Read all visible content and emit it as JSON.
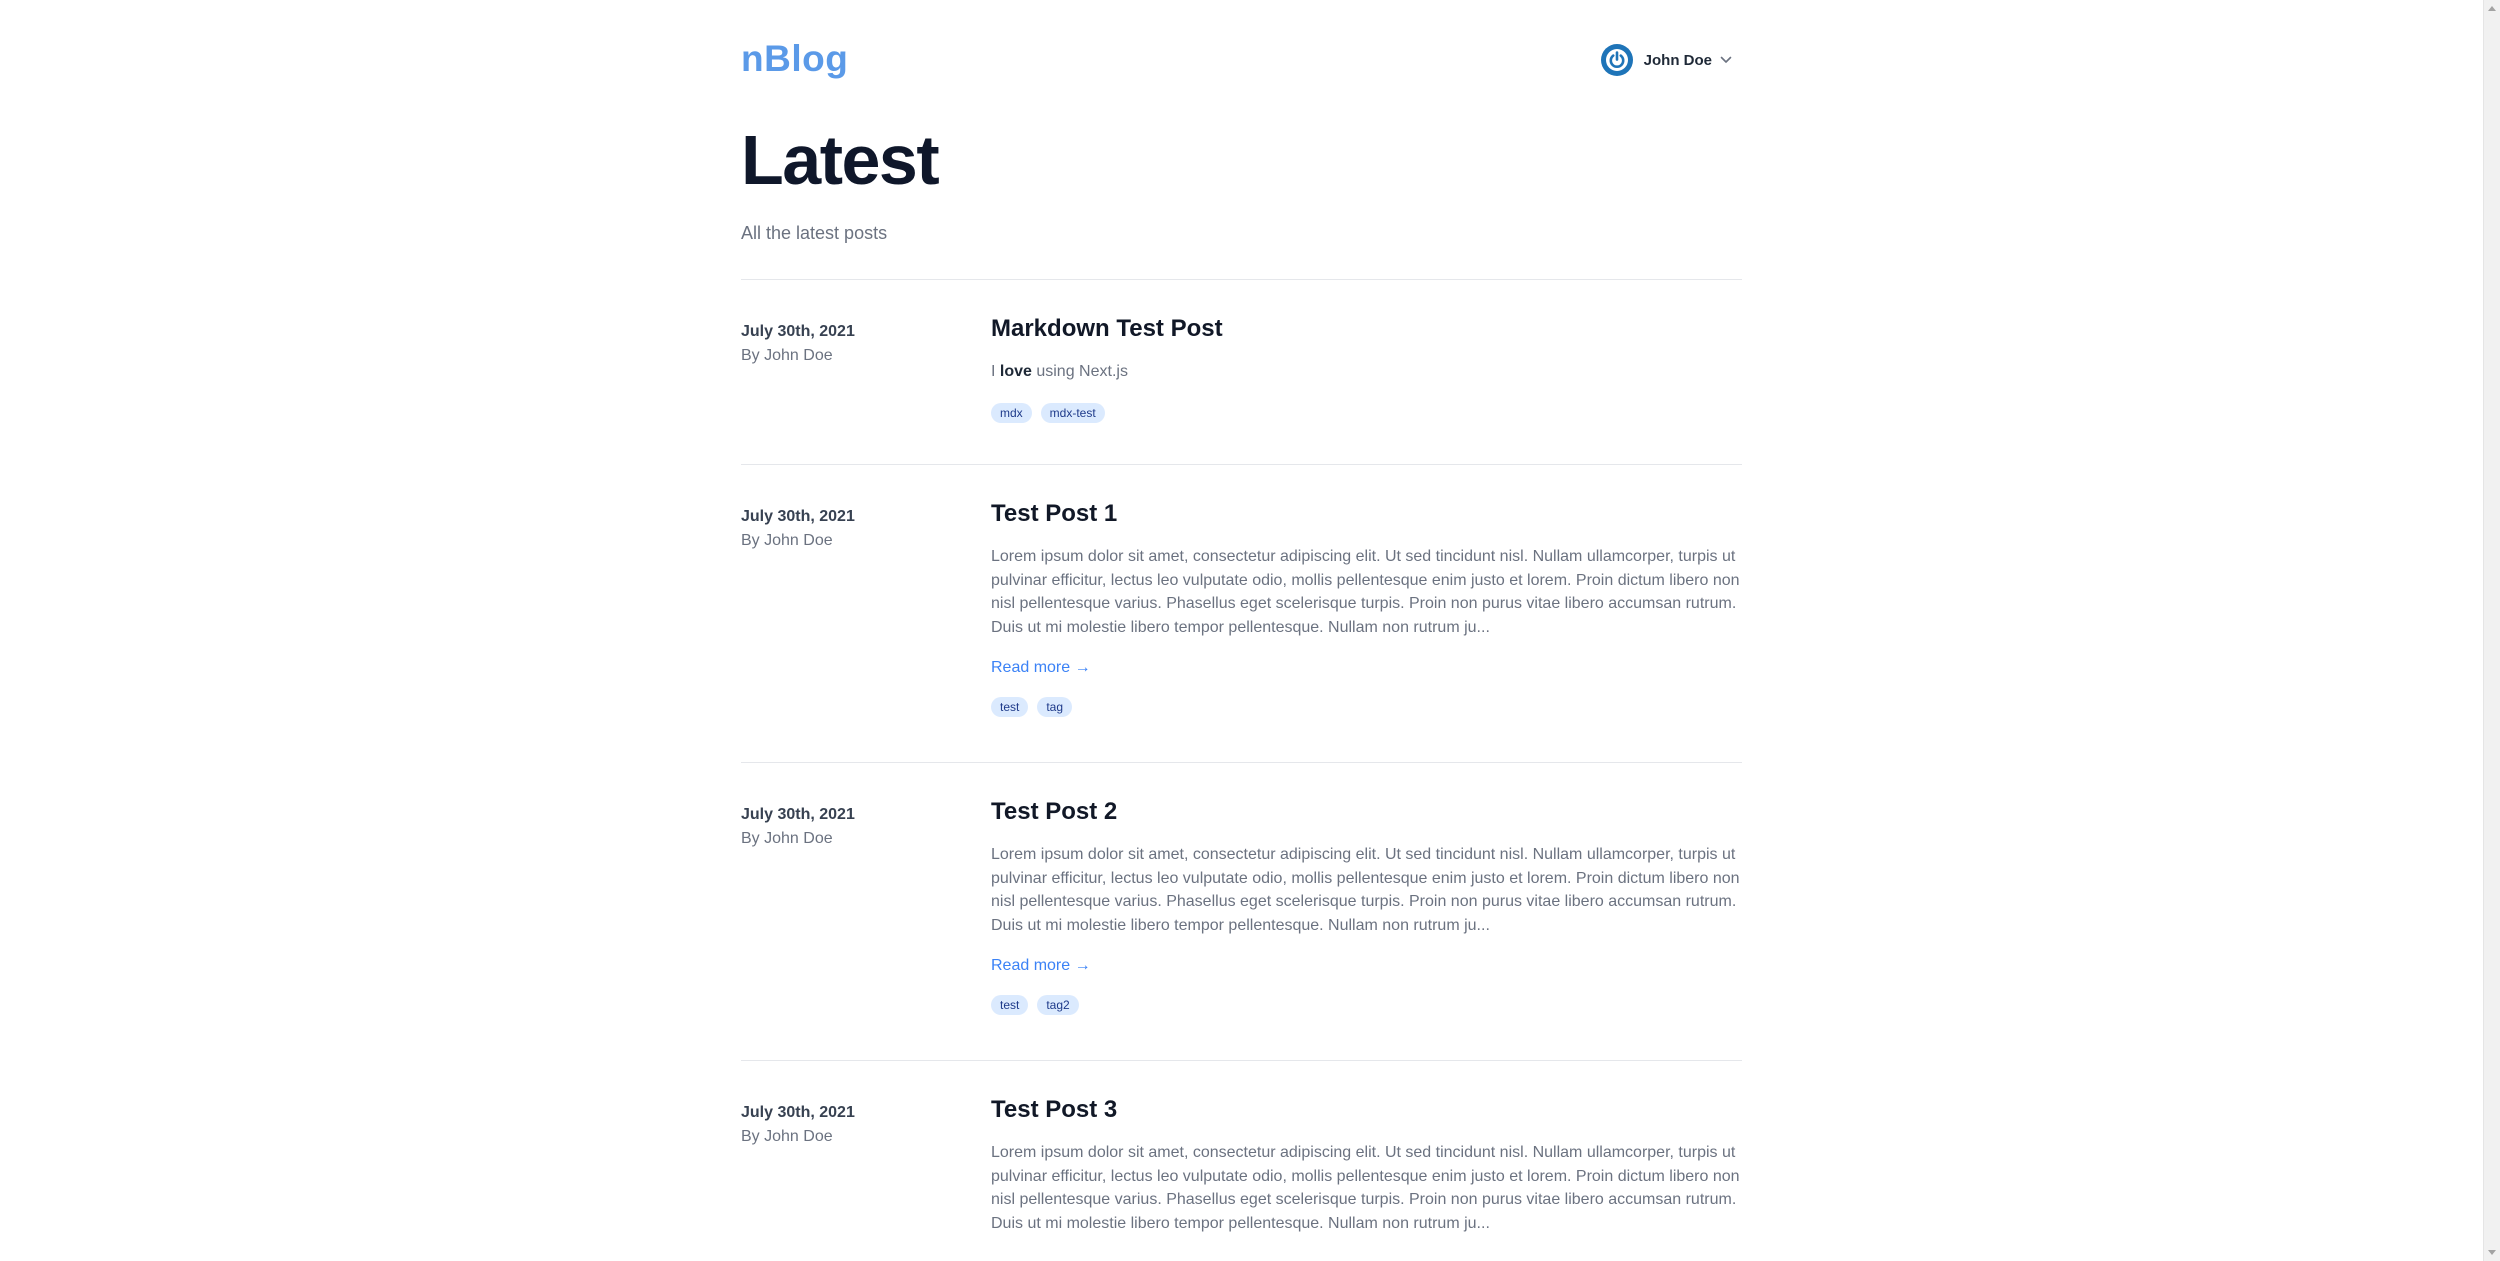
{
  "header": {
    "logo": "nBlog",
    "user_name": "John Doe",
    "avatar_icon": "power-icon",
    "menu_icon": "chevron-down-icon"
  },
  "page": {
    "title": "Latest",
    "subtitle": "All the latest posts"
  },
  "posts": [
    {
      "date": "July 30th, 2021",
      "author": "By John Doe",
      "title": "Markdown Test Post",
      "excerpt_pre": "I ",
      "excerpt_bold": "love",
      "excerpt_post": " using Next.js",
      "tags": [
        "mdx",
        "mdx-test"
      ]
    },
    {
      "date": "July 30th, 2021",
      "author": "By John Doe",
      "title": "Test Post 1",
      "excerpt": "Lorem ipsum dolor sit amet, consectetur adipiscing elit. Ut sed tincidunt nisl. Nullam ullamcorper, turpis ut pulvinar efficitur, lectus leo vulputate odio, mollis pellentesque enim justo et lorem. Proin dictum libero non nisl pellentesque varius. Phasellus eget scelerisque turpis. Proin non purus vitae libero accumsan rutrum. Duis ut mi molestie libero tempor pellentesque. Nullam non rutrum ju...",
      "read_more": "Read more →",
      "tags": [
        "test",
        "tag"
      ]
    },
    {
      "date": "July 30th, 2021",
      "author": "By John Doe",
      "title": "Test Post 2",
      "excerpt": "Lorem ipsum dolor sit amet, consectetur adipiscing elit. Ut sed tincidunt nisl. Nullam ullamcorper, turpis ut pulvinar efficitur, lectus leo vulputate odio, mollis pellentesque enim justo et lorem. Proin dictum libero non nisl pellentesque varius. Phasellus eget scelerisque turpis. Proin non purus vitae libero accumsan rutrum. Duis ut mi molestie libero tempor pellentesque. Nullam non rutrum ju...",
      "read_more": "Read more →",
      "tags": [
        "test",
        "tag2"
      ]
    },
    {
      "date": "July 30th, 2021",
      "author": "By John Doe",
      "title": "Test Post 3",
      "excerpt": "Lorem ipsum dolor sit amet, consectetur adipiscing elit. Ut sed tincidunt nisl. Nullam ullamcorper, turpis ut pulvinar efficitur, lectus leo vulputate odio, mollis pellentesque enim justo et lorem. Proin dictum libero non nisl pellentesque varius. Phasellus eget scelerisque turpis. Proin non purus vitae libero accumsan rutrum. Duis ut mi molestie libero tempor pellentesque. Nullam non rutrum ju...",
      "tags": []
    }
  ],
  "colors": {
    "brand": "#5b9ae8",
    "link": "#3b82f6",
    "tag_bg": "#dbeafe",
    "tag_text": "#1e3a8a",
    "avatar": "#1e74b8"
  }
}
